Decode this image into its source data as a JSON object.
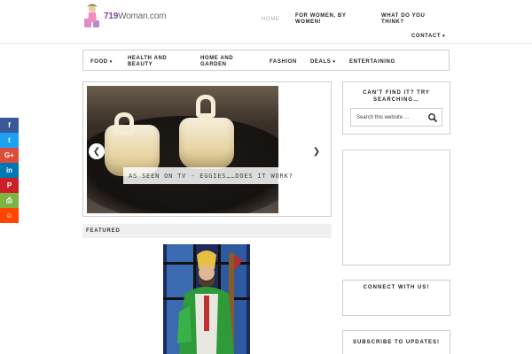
{
  "header": {
    "logo_text_prefix": "719",
    "logo_text_suffix": "Woman.com",
    "nav": [
      {
        "label": "Home"
      },
      {
        "label": "For Women, By Women!"
      },
      {
        "label": "What Do You Think?"
      },
      {
        "label": "Contact"
      }
    ]
  },
  "mainnav": {
    "items": [
      {
        "label": "Food",
        "has_dropdown": true
      },
      {
        "label": "Health and Beauty",
        "has_dropdown": false
      },
      {
        "label": "Home and Garden",
        "has_dropdown": false
      },
      {
        "label": "Fashion",
        "has_dropdown": false
      },
      {
        "label": "Deals",
        "has_dropdown": true
      },
      {
        "label": "Entertaining",
        "has_dropdown": false
      }
    ]
  },
  "social": {
    "buttons": [
      {
        "icon": "facebook-icon",
        "glyph": "f",
        "color": "#3b5998"
      },
      {
        "icon": "twitter-icon",
        "glyph": "t",
        "color": "#1da1f2"
      },
      {
        "icon": "google-plus-icon",
        "glyph": "G+",
        "color": "#dd4b39"
      },
      {
        "icon": "linkedin-icon",
        "glyph": "in",
        "color": "#0077b5"
      },
      {
        "icon": "pinterest-icon",
        "glyph": "P",
        "color": "#cb2027"
      },
      {
        "icon": "print-icon",
        "glyph": "⎙",
        "color": "#7cb342"
      },
      {
        "icon": "reddit-icon",
        "glyph": "☺",
        "color": "#ff4500"
      }
    ]
  },
  "slider": {
    "caption": "As Seen On TV - Eggies……Does it work?",
    "prev_glyph": "❮",
    "next_glyph": "❯"
  },
  "featured": {
    "label": "Featured"
  },
  "sidebar": {
    "search_title_1": "Can't find it? Try",
    "search_title_2": "searching…",
    "search_placeholder": "Search this website …",
    "connect_title": "Connect with us!",
    "subscribe_title": "Subscribe to Updates!"
  }
}
